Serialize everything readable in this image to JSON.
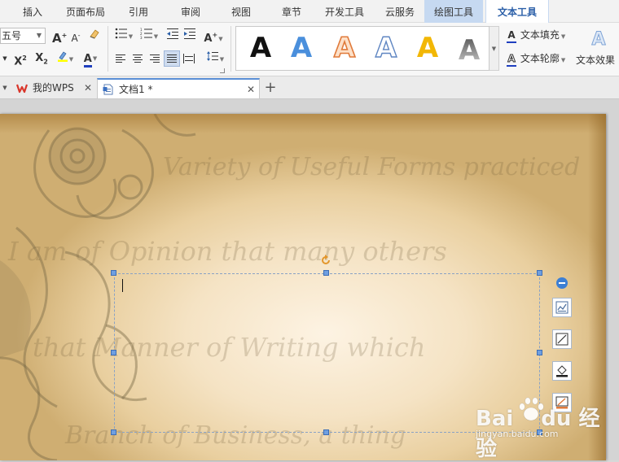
{
  "ribbon_tabs": [
    {
      "label": "插入"
    },
    {
      "label": "页面布局"
    },
    {
      "label": "引用"
    },
    {
      "label": "审阅"
    },
    {
      "label": "视图"
    },
    {
      "label": "章节"
    },
    {
      "label": "开发工具"
    },
    {
      "label": "云服务"
    },
    {
      "label": "绘图工具"
    },
    {
      "label": "文本工具"
    }
  ],
  "active_tab": "文本工具",
  "font": {
    "size": "五号"
  },
  "text_style_gallery": {
    "sample_glyph": "A",
    "styles": [
      "black",
      "blue",
      "orange-outline",
      "blue-outline",
      "yellow",
      "gray-gradient"
    ]
  },
  "text_tools": {
    "fill_label": "文本填充",
    "outline_label": "文本轮廓",
    "effect_label": "文本效果",
    "icon_glyph": "A"
  },
  "doc_tabs": [
    {
      "label": "我的WPS",
      "icon": "wps-logo-icon"
    },
    {
      "label": "文档1 *",
      "icon": "document-icon"
    }
  ],
  "document": {
    "background_script": [
      "Variety of Useful Forms practiced",
      "I am of Opinion that many others",
      "that Manner of Writing which",
      "Branch of Business, a thing"
    ]
  },
  "watermark": {
    "brand": "Bai",
    "brand_suffix": "du",
    "product": "经验",
    "url": "jingyan.baidu.com"
  },
  "colors": {
    "accent": "#2b5fa8",
    "context_tab": "#c6d9f1",
    "selection_handle": "#6f9fe0",
    "font_color_underline": "#1f3fbf",
    "highlight_yellow": "#ffff00"
  }
}
